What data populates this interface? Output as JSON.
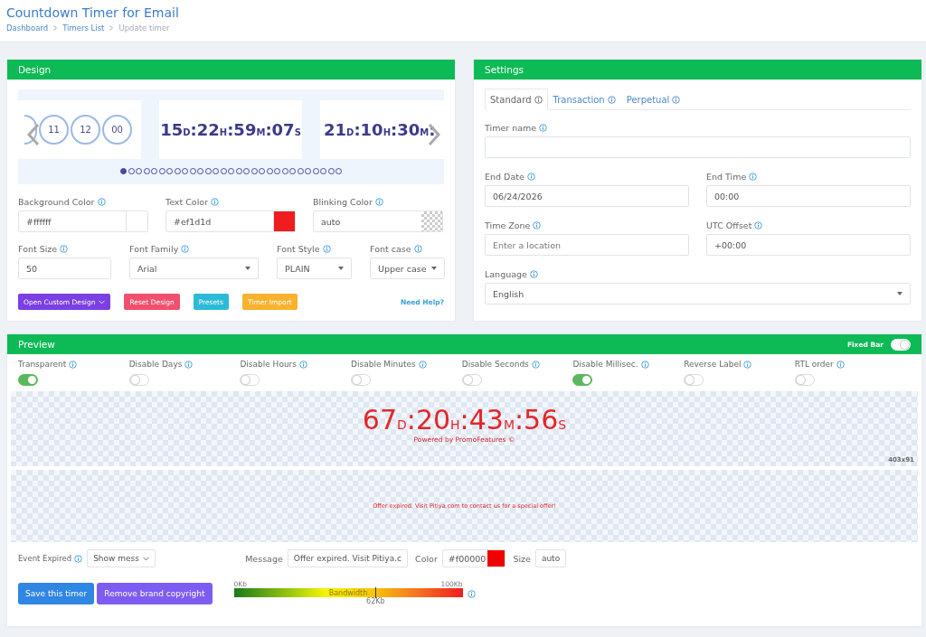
{
  "header": {
    "title": "Countdown Timer for Email",
    "breadcrumb": [
      {
        "label": "Dashboard",
        "kind": "link"
      },
      {
        "label": "Timers List",
        "kind": "link"
      },
      {
        "label": "Update timer",
        "kind": "current"
      }
    ]
  },
  "design": {
    "title": "Design",
    "carousel": {
      "slides": [
        {
          "kind": "circles",
          "segments": [
            {
              "value": "11"
            },
            {
              "value": "12"
            },
            {
              "value": "00"
            }
          ]
        },
        {
          "kind": "digits",
          "segments": [
            {
              "value": "15",
              "unit": "D",
              "sep": ":"
            },
            {
              "value": "22",
              "unit": "H",
              "sep": ":"
            },
            {
              "value": "59",
              "unit": "M",
              "sep": ":"
            },
            {
              "value": "07",
              "unit": "S"
            }
          ]
        },
        {
          "kind": "digits",
          "segments": [
            {
              "value": "21",
              "unit": "D",
              "sep": ":"
            },
            {
              "value": "10",
              "unit": "H",
              "sep": ":"
            },
            {
              "value": "30",
              "unit": "M",
              "sep": ":"
            }
          ]
        }
      ],
      "pages": [
        {
          "selected": true
        },
        {
          "selected": false
        },
        {
          "selected": false
        },
        {
          "selected": false
        },
        {
          "selected": false
        },
        {
          "selected": false
        },
        {
          "selected": false
        },
        {
          "selected": false
        },
        {
          "selected": false
        },
        {
          "selected": false
        },
        {
          "selected": false
        },
        {
          "selected": false
        },
        {
          "selected": false
        },
        {
          "selected": false
        },
        {
          "selected": false
        },
        {
          "selected": false
        },
        {
          "selected": false
        },
        {
          "selected": false
        },
        {
          "selected": false
        },
        {
          "selected": false
        },
        {
          "selected": false
        },
        {
          "selected": false
        },
        {
          "selected": false
        },
        {
          "selected": false
        },
        {
          "selected": false
        },
        {
          "selected": false
        },
        {
          "selected": false
        },
        {
          "selected": false
        },
        {
          "selected": false
        }
      ]
    },
    "colors": [
      {
        "label": "Background Color",
        "value": "#ffffff",
        "color": "#ffffff"
      },
      {
        "label": "Text Color",
        "value": "#ef1d1d",
        "color": "#ef1d1d"
      },
      {
        "label": "Blinking Color",
        "value": "auto"
      }
    ],
    "fonts": [
      {
        "label": "Font Size",
        "value": "50",
        "kind": "input"
      },
      {
        "label": "Font Family",
        "value": "Arial",
        "kind": "select"
      },
      {
        "label": "Font Style",
        "value": "PLAIN",
        "kind": "select"
      },
      {
        "label": "Font case",
        "value": "Upper case",
        "kind": "select"
      }
    ],
    "buttons": [
      {
        "label": "Open Custom Design",
        "color": "#7b3fe4",
        "caret": true
      },
      {
        "label": "Reset Design",
        "color": "#f0506e",
        "caret": false
      },
      {
        "label": "Presets",
        "color": "#2bbbd8",
        "caret": false
      },
      {
        "label": "Timer Import",
        "color": "#f8b22e",
        "caret": false
      }
    ],
    "help_link": "Need Help?"
  },
  "settings": {
    "title": "Settings",
    "tabs": [
      {
        "label": "Standard",
        "selected": true
      },
      {
        "label": "Transaction",
        "selected": false
      },
      {
        "label": "Perpetual",
        "selected": false
      }
    ],
    "rows": [
      [
        {
          "label": "Timer name",
          "kind": "input"
        }
      ],
      [
        {
          "label": "End Date",
          "value": "06/24/2026",
          "kind": "input"
        },
        {
          "label": "End Time",
          "value": "00:00",
          "kind": "input"
        }
      ],
      [
        {
          "label": "Time Zone",
          "placeholder": "Enter a location",
          "kind": "input"
        },
        {
          "label": "UTC Offset",
          "value": "+00:00",
          "kind": "input"
        }
      ],
      [
        {
          "label": "Language",
          "value": "English",
          "kind": "select"
        }
      ]
    ]
  },
  "preview": {
    "title": "Preview",
    "fixed_bar": {
      "label": "Fixed Bar",
      "on": true
    },
    "options": [
      {
        "label": "Transparent",
        "on": true
      },
      {
        "label": "Disable Days",
        "on": false
      },
      {
        "label": "Disable Hours",
        "on": false
      },
      {
        "label": "Disable Minutes",
        "on": false
      },
      {
        "label": "Disable Seconds",
        "on": false
      },
      {
        "label": "Disable Millisec.",
        "on": true
      },
      {
        "label": "Reverse Label",
        "on": false
      },
      {
        "label": "RTL order",
        "on": false
      }
    ],
    "timer": [
      {
        "value": "67",
        "unit": "D",
        "sep": ":"
      },
      {
        "value": "20",
        "unit": "H",
        "sep": ":"
      },
      {
        "value": "43",
        "unit": "M",
        "sep": ":"
      },
      {
        "value": "56",
        "unit": "S"
      }
    ],
    "powered_by": "Powered by PromoFeatures ©",
    "size_label": "403x91",
    "expired_text": "Offer expired. Visit Pitiya.com to contact us for a special offer!",
    "fields": [
      {
        "label": "Event Expired",
        "value": "Show mess",
        "kind": "select",
        "info": true
      },
      {
        "label": "Message",
        "value": "Offer expired. Visit Pitiya.c",
        "kind": "input",
        "info": false
      },
      {
        "label": "Color",
        "value": "#f00000",
        "kind": "color",
        "color": "#f00000",
        "info": false
      },
      {
        "label": "Size",
        "value": "auto",
        "kind": "input",
        "info": false
      }
    ],
    "buttons": [
      {
        "label": "Save this timer",
        "color": "#2f86e3"
      },
      {
        "label": "Remove brand copyright",
        "color": "#7d5cf2"
      }
    ],
    "bandwidth": {
      "label": "Bandwidth",
      "min": "0Kb",
      "max": "100Kb",
      "reading": "62Kb",
      "level": 0.62
    }
  }
}
